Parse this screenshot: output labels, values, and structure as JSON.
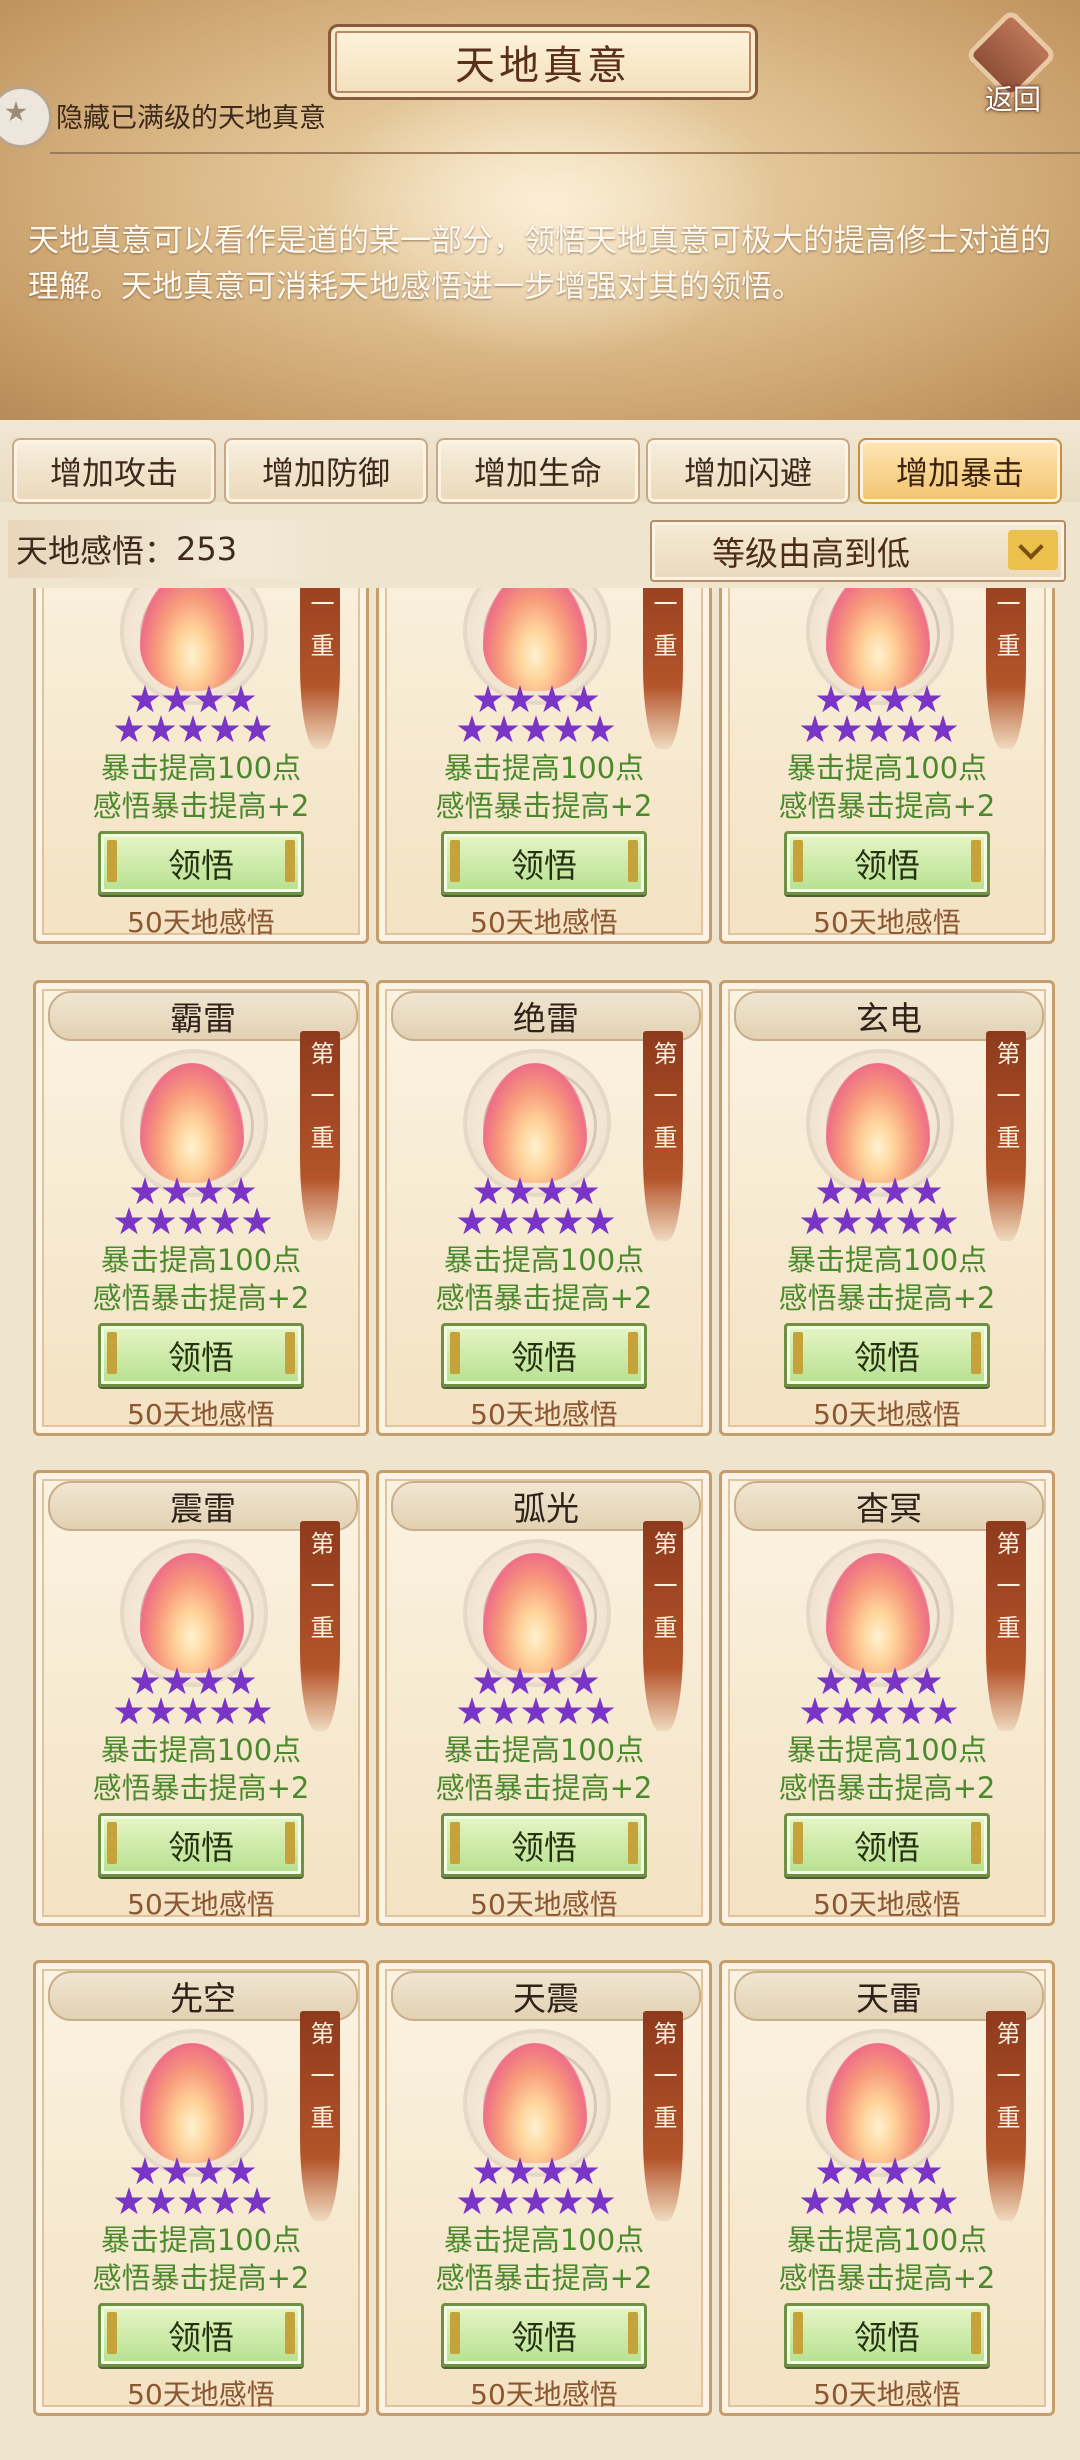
{
  "header": {
    "title": "天地真意",
    "back_label": "返回",
    "hide_maxed_label": "隐藏已满级的天地真意",
    "description": "天地真意可以看作是道的某一部分，领悟天地真意可极大的提高修士对道的理解。天地真意可消耗天地感悟进一步增强对其的领悟。"
  },
  "tabs": [
    {
      "label": "增加攻击",
      "active": false
    },
    {
      "label": "增加防御",
      "active": false
    },
    {
      "label": "增加生命",
      "active": false
    },
    {
      "label": "增加闪避",
      "active": false
    },
    {
      "label": "增加暴击",
      "active": true
    }
  ],
  "points": {
    "label": "天地感悟：",
    "value": "253"
  },
  "sort": {
    "selected": "等级由高到低"
  },
  "cards": [
    {
      "name": "",
      "rank": "第一重",
      "stars": 9,
      "stat1": "暴击提高100点",
      "stat2": "感悟暴击提高+2",
      "button": "领悟",
      "cost": "50天地感悟"
    },
    {
      "name": "",
      "rank": "第一重",
      "stars": 9,
      "stat1": "暴击提高100点",
      "stat2": "感悟暴击提高+2",
      "button": "领悟",
      "cost": "50天地感悟"
    },
    {
      "name": "",
      "rank": "第一重",
      "stars": 9,
      "stat1": "暴击提高100点",
      "stat2": "感悟暴击提高+2",
      "button": "领悟",
      "cost": "50天地感悟"
    },
    {
      "name": "霸雷",
      "rank": "第一重",
      "stars": 9,
      "stat1": "暴击提高100点",
      "stat2": "感悟暴击提高+2",
      "button": "领悟",
      "cost": "50天地感悟"
    },
    {
      "name": "绝雷",
      "rank": "第一重",
      "stars": 9,
      "stat1": "暴击提高100点",
      "stat2": "感悟暴击提高+2",
      "button": "领悟",
      "cost": "50天地感悟"
    },
    {
      "name": "玄电",
      "rank": "第一重",
      "stars": 9,
      "stat1": "暴击提高100点",
      "stat2": "感悟暴击提高+2",
      "button": "领悟",
      "cost": "50天地感悟"
    },
    {
      "name": "震雷",
      "rank": "第一重",
      "stars": 9,
      "stat1": "暴击提高100点",
      "stat2": "感悟暴击提高+2",
      "button": "领悟",
      "cost": "50天地感悟"
    },
    {
      "name": "弧光",
      "rank": "第一重",
      "stars": 9,
      "stat1": "暴击提高100点",
      "stat2": "感悟暴击提高+2",
      "button": "领悟",
      "cost": "50天地感悟"
    },
    {
      "name": "杳冥",
      "rank": "第一重",
      "stars": 9,
      "stat1": "暴击提高100点",
      "stat2": "感悟暴击提高+2",
      "button": "领悟",
      "cost": "50天地感悟"
    },
    {
      "name": "先空",
      "rank": "第一重",
      "stars": 9,
      "stat1": "暴击提高100点",
      "stat2": "感悟暴击提高+2",
      "button": "领悟",
      "cost": "50天地感悟"
    },
    {
      "name": "天震",
      "rank": "第一重",
      "stars": 9,
      "stat1": "暴击提高100点",
      "stat2": "感悟暴击提高+2",
      "button": "领悟",
      "cost": "50天地感悟"
    },
    {
      "name": "天雷",
      "rank": "第一重",
      "stars": 9,
      "stat1": "暴击提高100点",
      "stat2": "感悟暴击提高+2",
      "button": "领悟",
      "cost": "50天地感悟"
    }
  ],
  "colors": {
    "stat_text": "#4b8a2c",
    "cost_text": "#8b5632",
    "star": "#7a35c7",
    "active_tab": "#f3c46f"
  }
}
